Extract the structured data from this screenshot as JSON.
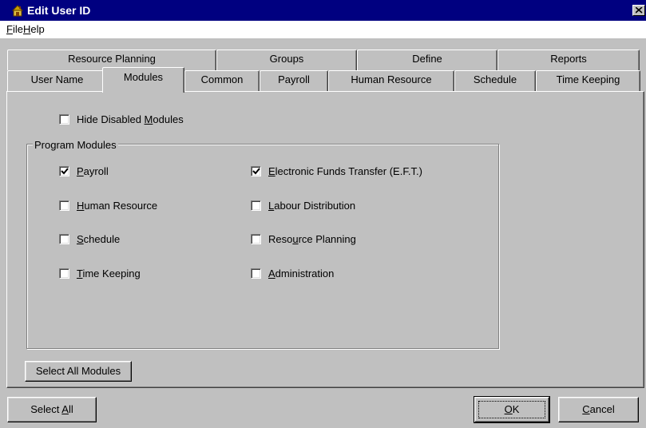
{
  "window": {
    "title": "Edit User ID",
    "icon": "app-house-icon"
  },
  "menu": [
    {
      "label": "File",
      "accel": "F",
      "rest": "ile"
    },
    {
      "label": "Help",
      "accel": "H",
      "rest": "elp"
    }
  ],
  "tabs_back": [
    "Resource Planning",
    "Groups",
    "Define",
    "Reports"
  ],
  "tabs_front": [
    "User Name",
    "Modules",
    "Common",
    "Payroll",
    "Human Resource",
    "Schedule",
    "Time Keeping"
  ],
  "active_tab": "Modules",
  "hide_disabled": {
    "pre": "Hide Disabled ",
    "accel": "M",
    "post": "odules",
    "checked": false
  },
  "program_modules": {
    "title": "Program Modules",
    "left": [
      {
        "label": "Payroll",
        "pre": "",
        "accel": "P",
        "post": "ayroll",
        "checked": true
      },
      {
        "label": "Human Resource",
        "pre": "",
        "accel": "H",
        "post": "uman Resource",
        "checked": false
      },
      {
        "label": "Schedule",
        "pre": "",
        "accel": "S",
        "post": "chedule",
        "checked": false
      },
      {
        "label": "Time Keeping",
        "pre": "",
        "accel": "T",
        "post": "ime Keeping",
        "checked": false
      }
    ],
    "right": [
      {
        "label": "Electronic Funds Transfer (E.F.T.)",
        "pre": "",
        "accel": "E",
        "post": "lectronic Funds Transfer (E.F.T.)",
        "checked": true
      },
      {
        "label": "Labour Distribution",
        "pre": "",
        "accel": "L",
        "post": "abour Distribution",
        "checked": false
      },
      {
        "label": "Resource Planning",
        "pre": "Reso",
        "accel": "u",
        "post": "rce Planning",
        "checked": false
      },
      {
        "label": "Administration",
        "pre": "",
        "accel": "A",
        "post": "dministration",
        "checked": false
      }
    ]
  },
  "buttons": {
    "select_all_modules": "Select All Modules",
    "select_all": {
      "pre": "Select ",
      "accel": "A",
      "post": "ll"
    },
    "ok": {
      "pre": "",
      "accel": "O",
      "post": "K"
    },
    "cancel": {
      "pre": "",
      "accel": "C",
      "post": "ancel"
    }
  }
}
